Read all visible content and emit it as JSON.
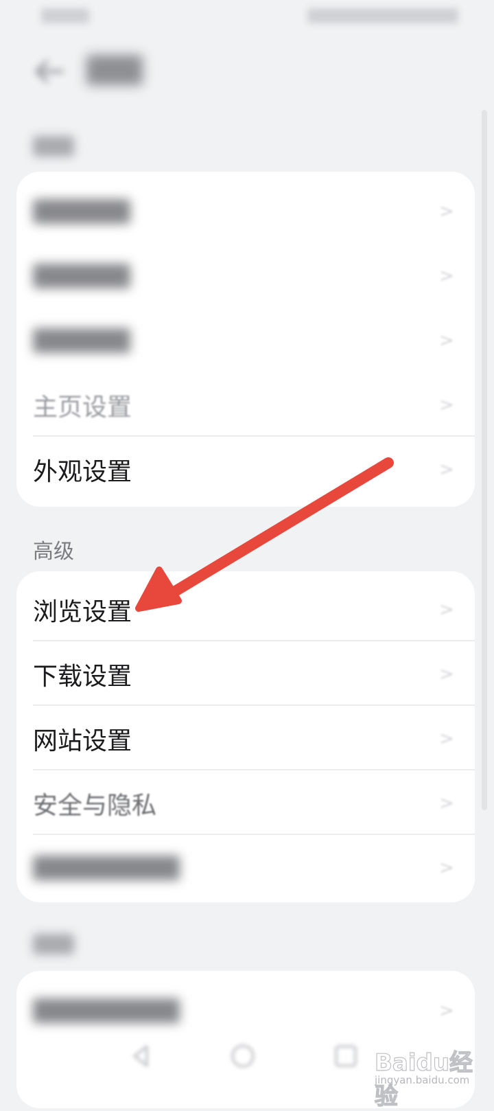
{
  "header": {
    "title": "设置"
  },
  "sections": [
    {
      "label": "",
      "items": [
        {
          "label": ""
        },
        {
          "label": ""
        },
        {
          "label": ""
        },
        {
          "label": "主页设置"
        },
        {
          "label": "外观设置"
        }
      ]
    },
    {
      "label": "高级",
      "items": [
        {
          "label": "浏览设置"
        },
        {
          "label": "下载设置"
        },
        {
          "label": "网站设置"
        },
        {
          "label": "安全与隐私"
        },
        {
          "label": ""
        }
      ]
    },
    {
      "label": "",
      "items": [
        {
          "label": ""
        }
      ]
    }
  ],
  "icons": {
    "back": "back-arrow-icon",
    "chevron": "chevron-right-icon",
    "annotation": "red-arrow-icon"
  },
  "colors": {
    "background": "#f1f2f4",
    "card": "#ffffff",
    "annotation_arrow": "#e8473c"
  },
  "watermark": {
    "brand": "Baidu经验",
    "sub": "jingyan.baidu.com"
  }
}
